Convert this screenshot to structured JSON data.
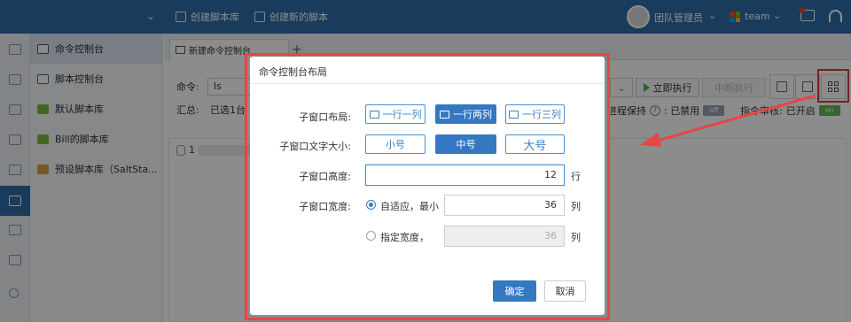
{
  "topbar": {
    "create_library": "创建脚本库",
    "create_script": "创建新的脚本",
    "admin": "团队管理员",
    "team": "team"
  },
  "sidebar": {
    "items": [
      {
        "label": "命令控制台",
        "icon": "terminal-icon"
      },
      {
        "label": "脚本控制台",
        "icon": "code-icon"
      },
      {
        "label": "默认脚本库",
        "icon": "database-icon"
      },
      {
        "label": "Bill的脚本库",
        "icon": "database-icon"
      },
      {
        "label": "预设脚本库（SaltSta...",
        "icon": "database-icon"
      }
    ]
  },
  "tabs": {
    "active": "新建命令控制台",
    "add": "+"
  },
  "command": {
    "label": "命令:",
    "value": "ls",
    "summary_label": "汇总:",
    "summary_value": "已选1台",
    "execute": "立即执行",
    "stop": "中断执行",
    "process_keep": "进程保持",
    "disabled_label": ": 已禁用",
    "toggle_off": "off",
    "audit": "指令审核:",
    "audit_state": "已开启",
    "toggle_on": "on",
    "output_prefix": "1"
  },
  "modal": {
    "title": "命令控制台布局",
    "layout_label": "子窗口布局:",
    "layout_options": [
      "一行一列",
      "一行两列",
      "一行三列"
    ],
    "layout_selected": 1,
    "font_label": "子窗口文字大小:",
    "font_options": [
      "小号",
      "中号",
      "大号"
    ],
    "font_selected": 1,
    "height_label": "子窗口高度:",
    "height_value": "12",
    "height_unit": "行",
    "width_label": "子窗口宽度:",
    "auto_label": "自适应，最小",
    "auto_value": "36",
    "auto_unit": "列",
    "fixed_label": "指定宽度，",
    "fixed_value": "36",
    "fixed_unit": "列",
    "width_mode": "auto",
    "ok": "确定",
    "cancel": "取消"
  },
  "colors": {
    "primary": "#3478c2",
    "topbar": "#2f6ea8",
    "highlight": "#e23b3b"
  }
}
